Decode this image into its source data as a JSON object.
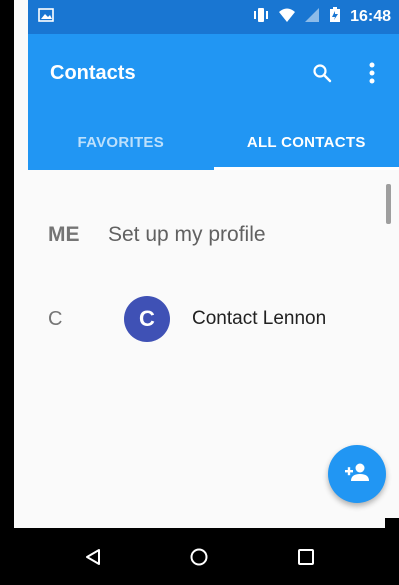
{
  "status_bar": {
    "time": "16:48",
    "icons": [
      "gallery-notification-icon",
      "vibrate-icon",
      "wifi-icon",
      "signal-icon",
      "battery-icon"
    ]
  },
  "app_bar": {
    "title": "Contacts",
    "icons": [
      "search-icon",
      "more-vert-icon"
    ]
  },
  "tabs": [
    {
      "label": "FAVORITES",
      "active": false
    },
    {
      "label": "ALL CONTACTS",
      "active": true
    }
  ],
  "list": {
    "me_section": {
      "letter": "ME",
      "text": "Set up my profile"
    },
    "contacts": [
      {
        "section": "C",
        "avatar_letter": "C",
        "name": "Contact Lennon"
      }
    ]
  },
  "fab": {
    "icon": "add-person-icon"
  },
  "nav_bar": {
    "icons": [
      "back-icon",
      "home-icon",
      "recents-icon"
    ]
  },
  "colors": {
    "primary": "#2196f3",
    "primary_dark": "#1976d2",
    "avatar": "#3f51b5"
  }
}
